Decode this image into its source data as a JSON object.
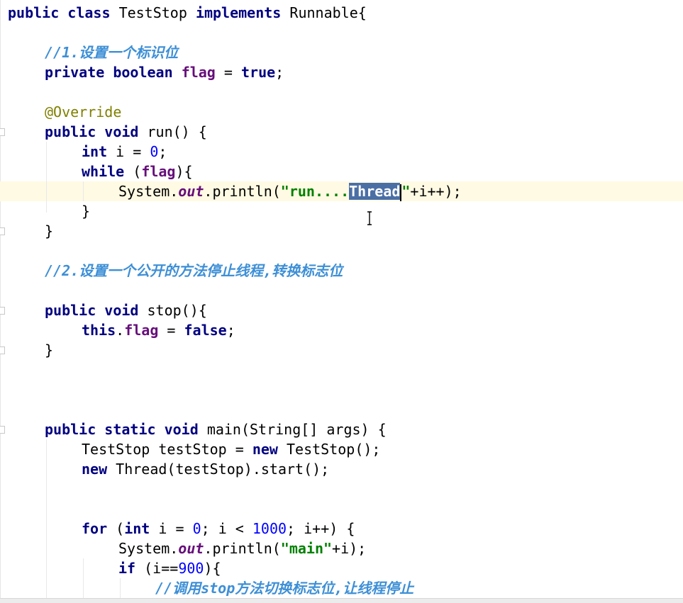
{
  "editor": {
    "language": "java",
    "selected_text": "Thread",
    "lines": {
      "l1": [
        "public",
        "class",
        "TestStop",
        "implements",
        "Runnable{"
      ],
      "l2_comment": "//1.设置一个标识位",
      "l3": [
        "private",
        "boolean",
        "flag",
        "=",
        "true",
        ";"
      ],
      "l4_annotation": "@Override",
      "l5": [
        "public",
        "void",
        "run() {"
      ],
      "l6": [
        "int",
        "i = ",
        "0",
        ";"
      ],
      "l7": [
        "while",
        "(",
        "flag",
        "){"
      ],
      "l8": [
        "System.",
        "out",
        ".println(",
        "\"run....",
        "Thread",
        "\"",
        "+i++);"
      ],
      "l9": "}",
      "l10": "}",
      "l11_comment": "//2.设置一个公开的方法停止线程,转换标志位",
      "l12": [
        "public",
        "void",
        "stop(){"
      ],
      "l13": [
        "this",
        ".",
        "flag",
        " = ",
        "false",
        ";"
      ],
      "l14": "}",
      "l15": [
        "public",
        "static",
        "void",
        "main(String[] args) {"
      ],
      "l16": [
        "TestStop testStop = ",
        "new",
        " TestStop();"
      ],
      "l17": [
        "new",
        " Thread(testStop).start();"
      ],
      "l18": [
        "for",
        " (",
        "int",
        " i = ",
        "0",
        "; i < ",
        "1000",
        "; i++) {"
      ],
      "l19": [
        "System.",
        "out",
        ".println(",
        "\"main\"",
        "+i);"
      ],
      "l20": [
        "if",
        " (i==",
        "900",
        "){"
      ],
      "l21_comment": "//调用stop方法切换标志位,让线程停止"
    }
  },
  "colors": {
    "keyword": "#000080",
    "field": "#660e7a",
    "string": "#008000",
    "number": "#0000ff",
    "annotation": "#808000",
    "comment": "#3d8fd6",
    "selection": "#4a6fa5",
    "caret_row": "#fffae3"
  },
  "icons": {
    "fold": "fold-marker-icon",
    "cursor": "ibeam-cursor-icon"
  }
}
